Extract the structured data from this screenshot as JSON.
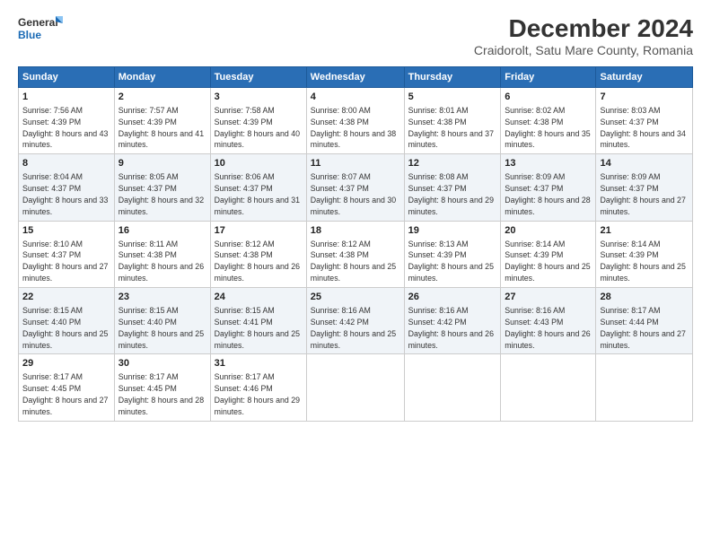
{
  "logo": {
    "line1": "General",
    "line2": "Blue"
  },
  "title": "December 2024",
  "subtitle": "Craidorolt, Satu Mare County, Romania",
  "days_header": [
    "Sunday",
    "Monday",
    "Tuesday",
    "Wednesday",
    "Thursday",
    "Friday",
    "Saturday"
  ],
  "weeks": [
    [
      {
        "day": "1",
        "rise": "Sunrise: 7:56 AM",
        "set": "Sunset: 4:39 PM",
        "daylight": "Daylight: 8 hours and 43 minutes."
      },
      {
        "day": "2",
        "rise": "Sunrise: 7:57 AM",
        "set": "Sunset: 4:39 PM",
        "daylight": "Daylight: 8 hours and 41 minutes."
      },
      {
        "day": "3",
        "rise": "Sunrise: 7:58 AM",
        "set": "Sunset: 4:39 PM",
        "daylight": "Daylight: 8 hours and 40 minutes."
      },
      {
        "day": "4",
        "rise": "Sunrise: 8:00 AM",
        "set": "Sunset: 4:38 PM",
        "daylight": "Daylight: 8 hours and 38 minutes."
      },
      {
        "day": "5",
        "rise": "Sunrise: 8:01 AM",
        "set": "Sunset: 4:38 PM",
        "daylight": "Daylight: 8 hours and 37 minutes."
      },
      {
        "day": "6",
        "rise": "Sunrise: 8:02 AM",
        "set": "Sunset: 4:38 PM",
        "daylight": "Daylight: 8 hours and 35 minutes."
      },
      {
        "day": "7",
        "rise": "Sunrise: 8:03 AM",
        "set": "Sunset: 4:37 PM",
        "daylight": "Daylight: 8 hours and 34 minutes."
      }
    ],
    [
      {
        "day": "8",
        "rise": "Sunrise: 8:04 AM",
        "set": "Sunset: 4:37 PM",
        "daylight": "Daylight: 8 hours and 33 minutes."
      },
      {
        "day": "9",
        "rise": "Sunrise: 8:05 AM",
        "set": "Sunset: 4:37 PM",
        "daylight": "Daylight: 8 hours and 32 minutes."
      },
      {
        "day": "10",
        "rise": "Sunrise: 8:06 AM",
        "set": "Sunset: 4:37 PM",
        "daylight": "Daylight: 8 hours and 31 minutes."
      },
      {
        "day": "11",
        "rise": "Sunrise: 8:07 AM",
        "set": "Sunset: 4:37 PM",
        "daylight": "Daylight: 8 hours and 30 minutes."
      },
      {
        "day": "12",
        "rise": "Sunrise: 8:08 AM",
        "set": "Sunset: 4:37 PM",
        "daylight": "Daylight: 8 hours and 29 minutes."
      },
      {
        "day": "13",
        "rise": "Sunrise: 8:09 AM",
        "set": "Sunset: 4:37 PM",
        "daylight": "Daylight: 8 hours and 28 minutes."
      },
      {
        "day": "14",
        "rise": "Sunrise: 8:09 AM",
        "set": "Sunset: 4:37 PM",
        "daylight": "Daylight: 8 hours and 27 minutes."
      }
    ],
    [
      {
        "day": "15",
        "rise": "Sunrise: 8:10 AM",
        "set": "Sunset: 4:37 PM",
        "daylight": "Daylight: 8 hours and 27 minutes."
      },
      {
        "day": "16",
        "rise": "Sunrise: 8:11 AM",
        "set": "Sunset: 4:38 PM",
        "daylight": "Daylight: 8 hours and 26 minutes."
      },
      {
        "day": "17",
        "rise": "Sunrise: 8:12 AM",
        "set": "Sunset: 4:38 PM",
        "daylight": "Daylight: 8 hours and 26 minutes."
      },
      {
        "day": "18",
        "rise": "Sunrise: 8:12 AM",
        "set": "Sunset: 4:38 PM",
        "daylight": "Daylight: 8 hours and 25 minutes."
      },
      {
        "day": "19",
        "rise": "Sunrise: 8:13 AM",
        "set": "Sunset: 4:39 PM",
        "daylight": "Daylight: 8 hours and 25 minutes."
      },
      {
        "day": "20",
        "rise": "Sunrise: 8:14 AM",
        "set": "Sunset: 4:39 PM",
        "daylight": "Daylight: 8 hours and 25 minutes."
      },
      {
        "day": "21",
        "rise": "Sunrise: 8:14 AM",
        "set": "Sunset: 4:39 PM",
        "daylight": "Daylight: 8 hours and 25 minutes."
      }
    ],
    [
      {
        "day": "22",
        "rise": "Sunrise: 8:15 AM",
        "set": "Sunset: 4:40 PM",
        "daylight": "Daylight: 8 hours and 25 minutes."
      },
      {
        "day": "23",
        "rise": "Sunrise: 8:15 AM",
        "set": "Sunset: 4:40 PM",
        "daylight": "Daylight: 8 hours and 25 minutes."
      },
      {
        "day": "24",
        "rise": "Sunrise: 8:15 AM",
        "set": "Sunset: 4:41 PM",
        "daylight": "Daylight: 8 hours and 25 minutes."
      },
      {
        "day": "25",
        "rise": "Sunrise: 8:16 AM",
        "set": "Sunset: 4:42 PM",
        "daylight": "Daylight: 8 hours and 25 minutes."
      },
      {
        "day": "26",
        "rise": "Sunrise: 8:16 AM",
        "set": "Sunset: 4:42 PM",
        "daylight": "Daylight: 8 hours and 26 minutes."
      },
      {
        "day": "27",
        "rise": "Sunrise: 8:16 AM",
        "set": "Sunset: 4:43 PM",
        "daylight": "Daylight: 8 hours and 26 minutes."
      },
      {
        "day": "28",
        "rise": "Sunrise: 8:17 AM",
        "set": "Sunset: 4:44 PM",
        "daylight": "Daylight: 8 hours and 27 minutes."
      }
    ],
    [
      {
        "day": "29",
        "rise": "Sunrise: 8:17 AM",
        "set": "Sunset: 4:45 PM",
        "daylight": "Daylight: 8 hours and 27 minutes."
      },
      {
        "day": "30",
        "rise": "Sunrise: 8:17 AM",
        "set": "Sunset: 4:45 PM",
        "daylight": "Daylight: 8 hours and 28 minutes."
      },
      {
        "day": "31",
        "rise": "Sunrise: 8:17 AM",
        "set": "Sunset: 4:46 PM",
        "daylight": "Daylight: 8 hours and 29 minutes."
      },
      null,
      null,
      null,
      null
    ]
  ]
}
